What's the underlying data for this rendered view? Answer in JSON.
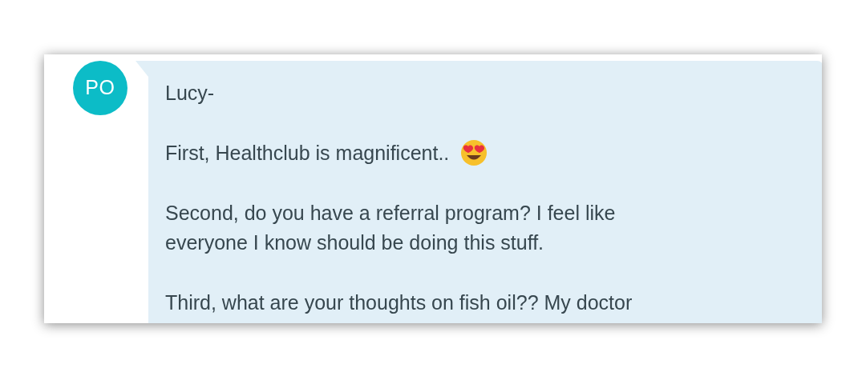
{
  "avatar": {
    "initials": "PO"
  },
  "message": {
    "paragraphs": [
      {
        "kind": "text",
        "text": "Lucy-"
      },
      {
        "kind": "text_with_emoji",
        "text": "First, Healthclub is magnificent.."
      },
      {
        "kind": "text",
        "text": "Second, do you have a referral program? I feel like everyone I know should be doing this stuff."
      },
      {
        "kind": "text",
        "text": "Third, what are your thoughts on fish oil?? My doctor"
      }
    ]
  }
}
